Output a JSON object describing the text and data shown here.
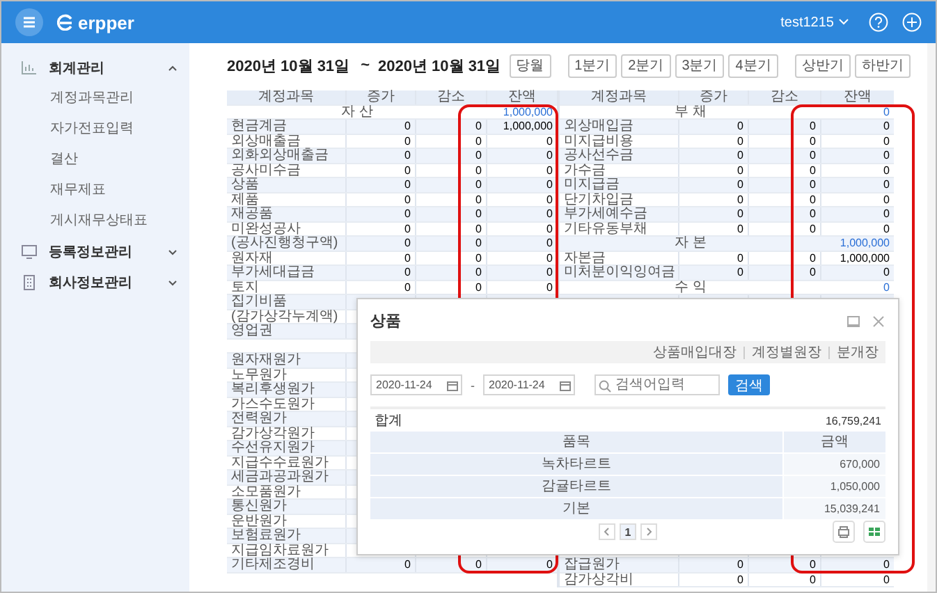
{
  "header": {
    "logo": "erpper",
    "user": "test1215"
  },
  "sidebar": {
    "items": [
      {
        "label": "회계관리",
        "expanded": true,
        "children": [
          {
            "label": "계정과목관리"
          },
          {
            "label": "자가전표입력"
          },
          {
            "label": "결산"
          },
          {
            "label": "재무제표"
          },
          {
            "label": "게시재무상태표"
          }
        ]
      },
      {
        "label": "등록정보관리",
        "expanded": false
      },
      {
        "label": "회사정보관리",
        "expanded": false
      }
    ]
  },
  "period": {
    "start": "2020년 10월 31일",
    "separator": "~",
    "end": "2020년 10월 31일"
  },
  "period_buttons": [
    {
      "buttons": [
        "당월"
      ]
    },
    {
      "buttons": [
        "1분기",
        "2분기",
        "3분기",
        "4분기"
      ]
    },
    {
      "buttons": [
        "상반기",
        "하반기"
      ]
    }
  ],
  "tables": [
    {
      "columns": [
        "계정과목",
        "증가",
        "감소",
        "잔액"
      ],
      "rows": [
        {
          "kind": "section",
          "label": "자 산",
          "balance": "1,000,000"
        },
        {
          "kind": "account",
          "name": "현금계금",
          "increase": "0",
          "decrease": "0",
          "balance": "1,000,000"
        },
        {
          "kind": "account",
          "name": "외상매출금",
          "increase": "0",
          "decrease": "0",
          "balance": "0"
        },
        {
          "kind": "account",
          "name": "외화외상매출금",
          "increase": "0",
          "decrease": "0",
          "balance": "0"
        },
        {
          "kind": "account",
          "name": "공사미수금",
          "increase": "0",
          "decrease": "0",
          "balance": "0"
        },
        {
          "kind": "account",
          "name": "상품",
          "increase": "0",
          "decrease": "0",
          "balance": "0"
        },
        {
          "kind": "account",
          "name": "제품",
          "increase": "0",
          "decrease": "0",
          "balance": "0"
        },
        {
          "kind": "account",
          "name": "재공품",
          "increase": "0",
          "decrease": "0",
          "balance": "0"
        },
        {
          "kind": "account",
          "name": "미완성공사",
          "increase": "0",
          "decrease": "0",
          "balance": "0"
        },
        {
          "kind": "account",
          "name": "(공사진행청구액)",
          "increase": "0",
          "decrease": "0",
          "balance": "0"
        },
        {
          "kind": "account",
          "name": "원자재",
          "increase": "0",
          "decrease": "0",
          "balance": "0"
        },
        {
          "kind": "account",
          "name": "부가세대급금",
          "increase": "0",
          "decrease": "0",
          "balance": "0"
        },
        {
          "kind": "account",
          "name": "토지",
          "increase": "0",
          "decrease": "0",
          "balance": "0"
        },
        {
          "kind": "account",
          "name": "집기비품"
        },
        {
          "kind": "account",
          "name": "(감가상각누계액)"
        },
        {
          "kind": "account",
          "name": "영업권"
        },
        {
          "kind": "section"
        },
        {
          "kind": "account",
          "name": "원자재원가"
        },
        {
          "kind": "account",
          "name": "노무원가"
        },
        {
          "kind": "account",
          "name": "복리후생원가"
        },
        {
          "kind": "account",
          "name": "가스수도원가"
        },
        {
          "kind": "account",
          "name": "전력원가"
        },
        {
          "kind": "account",
          "name": "감가상각원가"
        },
        {
          "kind": "account",
          "name": "수선유지원가"
        },
        {
          "kind": "account",
          "name": "지급수수료원가"
        },
        {
          "kind": "account",
          "name": "세금과공과원가"
        },
        {
          "kind": "account",
          "name": "소모품원가"
        },
        {
          "kind": "account",
          "name": "통신원가"
        },
        {
          "kind": "account",
          "name": "운반원가"
        },
        {
          "kind": "account",
          "name": "보험료원가"
        },
        {
          "kind": "account",
          "name": "지급임차료원가"
        },
        {
          "kind": "account",
          "name": "기타제조경비",
          "increase": "0",
          "decrease": "0",
          "balance": "0"
        }
      ]
    },
    {
      "columns": [
        "계정과목",
        "증가",
        "감소",
        "잔액"
      ],
      "rows": [
        {
          "kind": "section",
          "label": "부 채",
          "balance": "0"
        },
        {
          "kind": "account",
          "name": "외상매입금",
          "increase": "0",
          "decrease": "0",
          "balance": "0"
        },
        {
          "kind": "account",
          "name": "미지급비용",
          "increase": "0",
          "decrease": "0",
          "balance": "0"
        },
        {
          "kind": "account",
          "name": "공사선수금",
          "increase": "0",
          "decrease": "0",
          "balance": "0"
        },
        {
          "kind": "account",
          "name": "가수금",
          "increase": "0",
          "decrease": "0",
          "balance": "0"
        },
        {
          "kind": "account",
          "name": "미지급금",
          "increase": "0",
          "decrease": "0",
          "balance": "0"
        },
        {
          "kind": "account",
          "name": "단기차입금",
          "increase": "0",
          "decrease": "0",
          "balance": "0"
        },
        {
          "kind": "account",
          "name": "부가세예수금",
          "increase": "0",
          "decrease": "0",
          "balance": "0"
        },
        {
          "kind": "account",
          "name": "기타유동부채",
          "increase": "0",
          "decrease": "0",
          "balance": "0"
        },
        {
          "kind": "section",
          "label": "자 본",
          "balance": "1,000,000"
        },
        {
          "kind": "account",
          "name": "자본금",
          "increase": "0",
          "decrease": "0",
          "balance": "1,000,000"
        },
        {
          "kind": "account",
          "name": "미처분이익잉여금",
          "increase": "0",
          "decrease": "0",
          "balance": "0"
        },
        {
          "kind": "section",
          "label": "수 익",
          "balance": "0"
        },
        {
          "kind": "account"
        },
        {
          "kind": "account"
        },
        {
          "kind": "account"
        },
        {
          "kind": "account"
        },
        {
          "kind": "account"
        },
        {
          "kind": "account"
        },
        {
          "kind": "account"
        },
        {
          "kind": "account"
        },
        {
          "kind": "account"
        },
        {
          "kind": "account"
        },
        {
          "kind": "account"
        },
        {
          "kind": "account"
        },
        {
          "kind": "account"
        },
        {
          "kind": "account"
        },
        {
          "kind": "account"
        },
        {
          "kind": "account"
        },
        {
          "kind": "account"
        },
        {
          "kind": "account"
        },
        {
          "kind": "account",
          "name": "잡급원가",
          "increase": "0",
          "decrease": "0",
          "balance": "0"
        },
        {
          "kind": "account",
          "name": "감가상각비",
          "increase": "0",
          "decrease": "0",
          "balance": "0"
        }
      ]
    }
  ],
  "dialog": {
    "title": "상품",
    "links": [
      "상품매입대장",
      "계정별원장",
      "분개장"
    ],
    "date_from": "2020-11-24",
    "date_separator": "-",
    "date_to": "2020-11-24",
    "search": {
      "placeholder": "검색어입력"
    },
    "search_button": "검색",
    "total_label": "합계",
    "total": "16,759,241",
    "table": {
      "columns": [
        "품목",
        "금액"
      ],
      "rows": [
        [
          "녹차타르트",
          "670,000"
        ],
        [
          "감귤타르트",
          "1,050,000"
        ],
        [
          "기본",
          "15,039,241"
        ]
      ]
    },
    "pages": [
      {
        "label": "1",
        "selected": true
      }
    ]
  }
}
